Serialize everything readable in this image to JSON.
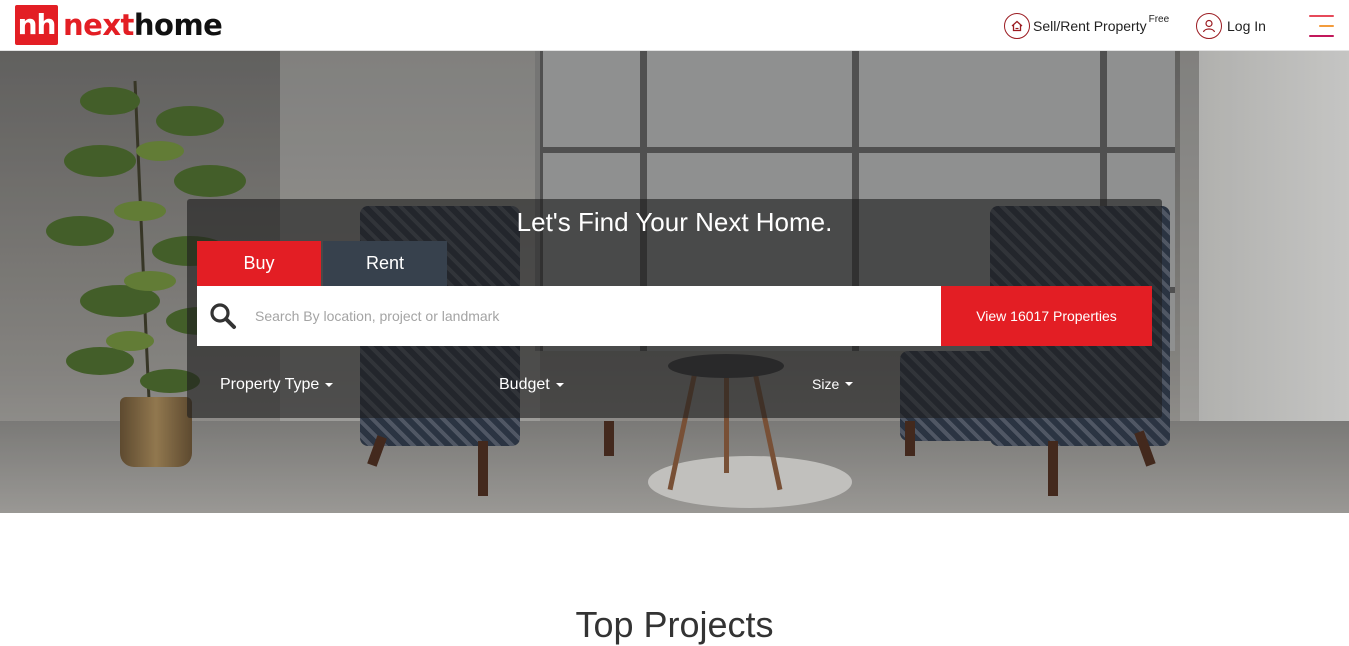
{
  "brand": {
    "mark": "nh",
    "name_part1": "next",
    "name_part2": "home"
  },
  "header": {
    "sell_label": "Sell/Rent Property",
    "sell_badge": "Free",
    "login_label": "Log In",
    "icons": {
      "sell": "home-circle-icon",
      "login": "user-circle-icon",
      "menu": "hamburger-menu-icon"
    }
  },
  "hero": {
    "title": "Let's Find Your Next Home.",
    "tabs": [
      {
        "label": "Buy",
        "active": true
      },
      {
        "label": "Rent",
        "active": false
      }
    ],
    "search": {
      "placeholder": "Search By location, project or landmark",
      "value": ""
    },
    "view_button": "View 16017 Properties",
    "filters": [
      {
        "label": "Property Type"
      },
      {
        "label": "Budget"
      },
      {
        "label": "Size"
      }
    ]
  },
  "sections": {
    "top_projects_title": "Top Projects"
  },
  "colors": {
    "accent": "#e31e24",
    "tab_inactive": "#37414d",
    "text_dark": "#222222"
  }
}
